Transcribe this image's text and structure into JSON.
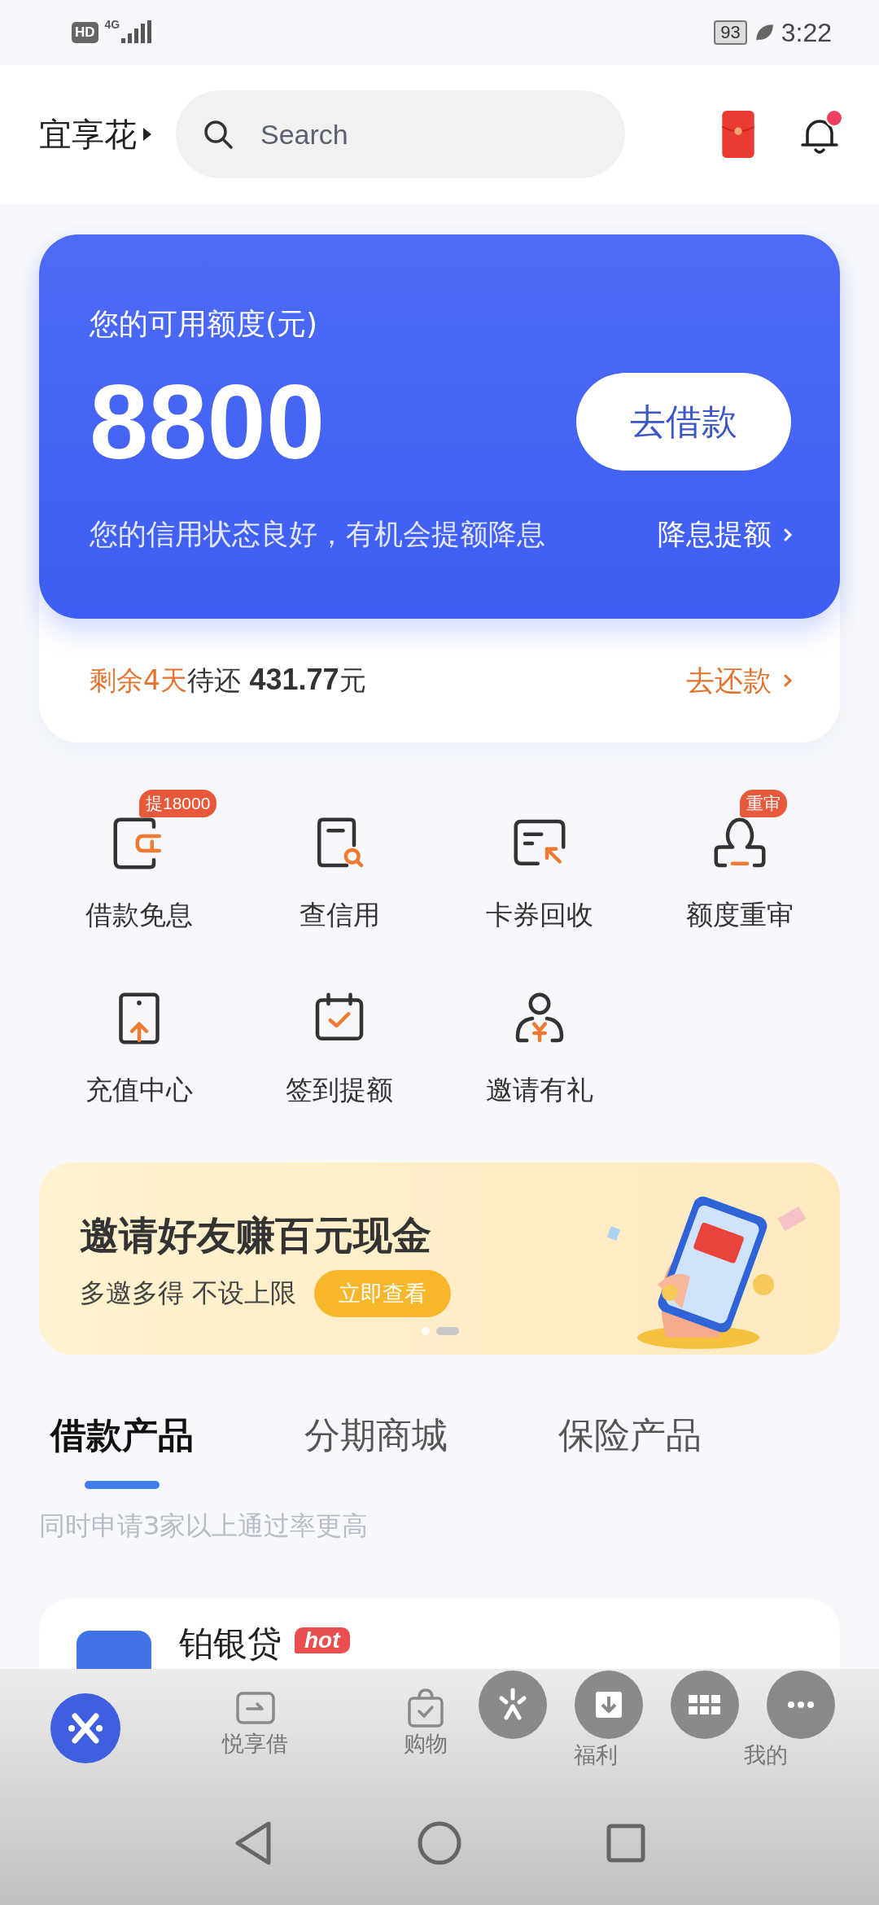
{
  "status_bar": {
    "hd": "HD",
    "network": "4G",
    "battery": "93",
    "time": "3:22"
  },
  "header": {
    "title": "宜享花",
    "search": {
      "placeholder": "Search"
    },
    "notification_dot": true
  },
  "credit": {
    "label": "您的可用额度(元)",
    "amount": "8800",
    "button": "去借款",
    "message": "您的信用状态良好，有机会提额降息",
    "link": "降息提额"
  },
  "repayment": {
    "due": "剩余4天",
    "label": "待还",
    "amount": "431.77",
    "unit": "元",
    "link": "去还款"
  },
  "services": [
    {
      "label": "借款免息",
      "badge": "提18000"
    },
    {
      "label": "查信用"
    },
    {
      "label": "卡券回收"
    },
    {
      "label": "额度重审",
      "badge": "重审"
    },
    {
      "label": "充值中心"
    },
    {
      "label": "签到提额"
    },
    {
      "label": "邀请有礼"
    }
  ],
  "banner": {
    "title": "邀请好友赚百元现金",
    "subtitle": "多邀多得 不设上限",
    "button": "立即查看",
    "pages": [
      {
        "selected": false
      },
      {
        "selected": true
      }
    ]
  },
  "tabs": [
    {
      "label": "借款产品",
      "selected": true
    },
    {
      "label": "分期商城",
      "selected": false
    },
    {
      "label": "保险产品",
      "selected": false
    }
  ],
  "hint": "同时申请3家以上通过率更高",
  "products": [
    {
      "name": "铂银贷",
      "badge": "hot"
    }
  ],
  "bottom_nav": [
    {
      "kind": "home",
      "selected": true
    },
    {
      "kind": "loan",
      "label": "悦享借",
      "selected": false
    },
    {
      "kind": "shop",
      "label": "购物",
      "selected": false
    },
    {
      "kind": "gift",
      "label": "福利",
      "selected": false
    },
    {
      "kind": "profile",
      "label": "我的",
      "selected": false
    }
  ]
}
